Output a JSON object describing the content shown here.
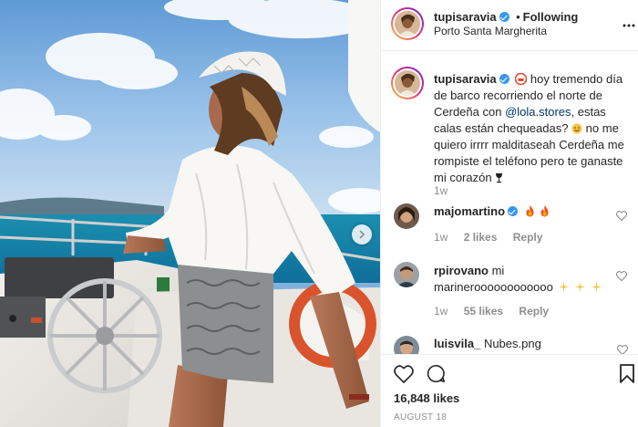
{
  "post_author": {
    "username": "tupisaravia",
    "verified": true,
    "separator": "•",
    "follow_status": "Following",
    "location": "Porto Santa Margherita"
  },
  "caption": {
    "username": "tupisaravia",
    "part1": " hoy tremendo día de barco recorriendo el norte de Cerdeña con ",
    "mention": "@lola.stores",
    "part2": ", estas calas están chequeadas? ",
    "part3": "  no me quiero irrrr malditaseah Cerdeña me rompiste el teléfono pero te ganaste mi corazón ",
    "time": "1w"
  },
  "comments": [
    {
      "username": "majomartino",
      "verified": true,
      "text": "",
      "time": "1w",
      "likes": "2 likes",
      "reply": "Reply"
    },
    {
      "username": "rpirovano",
      "verified": false,
      "text": "mi marineroooooooooooo",
      "time": "1w",
      "likes": "55 likes",
      "reply": "Reply"
    },
    {
      "username": "luisvila_",
      "verified": false,
      "text": "Nubes.png",
      "time": "",
      "likes": "",
      "reply": ""
    }
  ],
  "likes_count": "16,848 likes",
  "post_date": "August 18",
  "icons": {
    "more": "more-options-icon",
    "like": "heart-icon",
    "comment": "comment-icon",
    "save": "bookmark-icon",
    "next": "chevron-right-icon"
  },
  "colors": {
    "verified": "#3897f0",
    "muted": "#8e8e8e",
    "mention": "#003569",
    "border": "#efefef",
    "fire": "#f4511e"
  }
}
